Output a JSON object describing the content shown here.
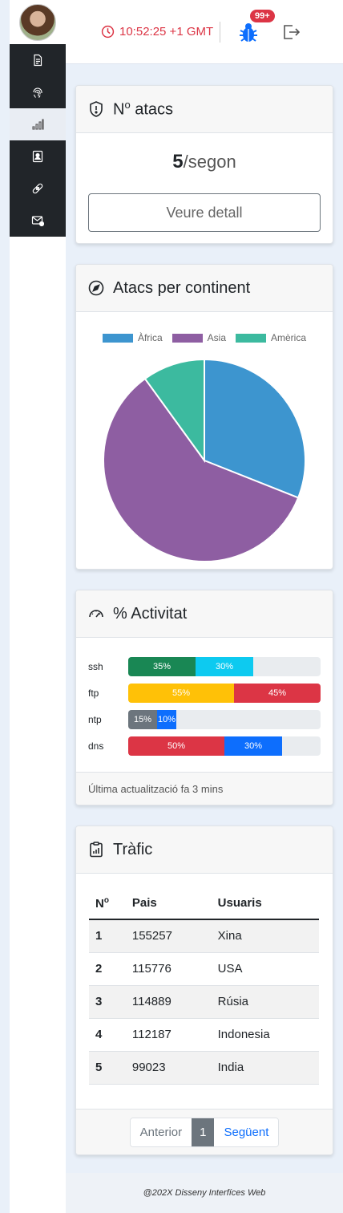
{
  "header": {
    "clock_time": "10:52:25 +1 GMT",
    "notification_badge": "99+"
  },
  "sidebar": {
    "items": [
      {
        "icon": "document-icon",
        "active": false
      },
      {
        "icon": "fingerprint-icon",
        "active": false
      },
      {
        "icon": "bar-chart-icon",
        "active": true
      },
      {
        "icon": "contact-card-icon",
        "active": false
      },
      {
        "icon": "bandage-icon",
        "active": false
      },
      {
        "icon": "mail-alert-icon",
        "active": false
      }
    ]
  },
  "attacks_card": {
    "title_prefix": "N",
    "title_sup": "o",
    "title_rest": " atacs",
    "rate_value": "5",
    "rate_unit": "/segon",
    "detail_button": "Veure detall"
  },
  "continent_card": {
    "title": "Atacs per continent"
  },
  "chart_data": {
    "type": "pie",
    "categories": [
      "Àfrica",
      "Asia",
      "Amèrica"
    ],
    "values": [
      31,
      59,
      10
    ],
    "colors": [
      "#3d95cf",
      "#8e5ea2",
      "#3cba9f"
    ],
    "legend": "top"
  },
  "activity_card": {
    "title": "% Activitat",
    "rows": [
      {
        "label": "ssh",
        "segments": [
          {
            "value": 35,
            "text": "35%",
            "color": "#198754"
          },
          {
            "value": 30,
            "text": "30%",
            "color": "#0dcaf0"
          }
        ]
      },
      {
        "label": "ftp",
        "segments": [
          {
            "value": 55,
            "text": "55%",
            "color": "#ffc107"
          },
          {
            "value": 45,
            "text": "45%",
            "color": "#dc3545"
          }
        ]
      },
      {
        "label": "ntp",
        "segments": [
          {
            "value": 15,
            "text": "15%",
            "color": "#6c757d"
          },
          {
            "value": 10,
            "text": "10%",
            "color": "#0d6efd"
          }
        ]
      },
      {
        "label": "dns",
        "segments": [
          {
            "value": 50,
            "text": "50%",
            "color": "#dc3545"
          },
          {
            "value": 30,
            "text": "30%",
            "color": "#0d6efd"
          }
        ]
      }
    ],
    "footer": "Última actualització fa 3 mins"
  },
  "traffic_card": {
    "title": "Tràfic",
    "columns": {
      "num_prefix": "N",
      "num_sup": "o",
      "country": "Pais",
      "users": "Usuaris"
    },
    "rows": [
      {
        "num": "1",
        "country": "155257",
        "users": "Xina"
      },
      {
        "num": "2",
        "country": "115776",
        "users": "USA"
      },
      {
        "num": "3",
        "country": "114889",
        "users": "Rúsia"
      },
      {
        "num": "4",
        "country": "112187",
        "users": "Indonesia"
      },
      {
        "num": "5",
        "country": "99023",
        "users": "India"
      }
    ],
    "pagination": {
      "prev": "Anterior",
      "current": "1",
      "next": "Següent"
    }
  },
  "footer": {
    "text": "@202X Disseny Interfíces Web"
  }
}
